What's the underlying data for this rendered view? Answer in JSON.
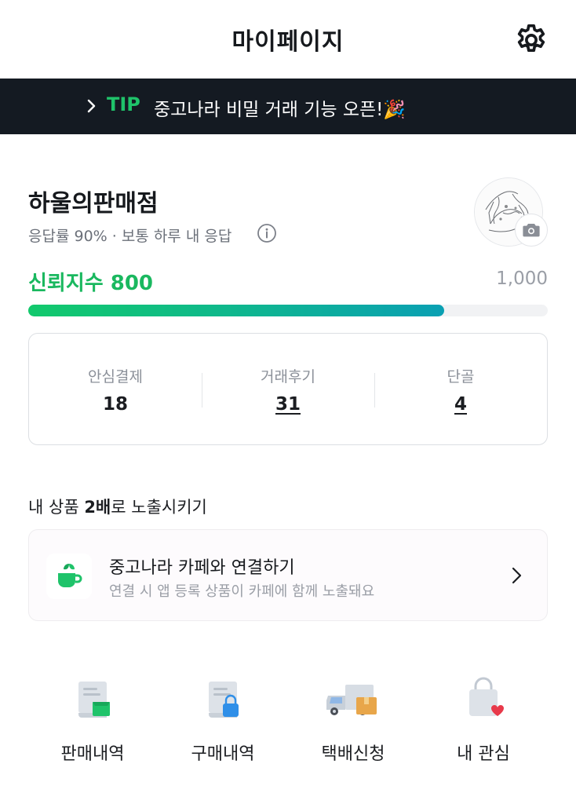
{
  "header": {
    "title": "마이페이지",
    "settings_icon": "gear-icon"
  },
  "tip": {
    "label": "TIP",
    "text": "중고나라 비밀 거래 기능 오픈!🎉"
  },
  "profile": {
    "store_name": "하울의판매점",
    "response_info": "응답률 90% · 보통 하루 내 응답",
    "camera_icon": "camera-icon"
  },
  "trust": {
    "label": "신뢰지수 800",
    "score": 800,
    "max_label": "1,000",
    "max": 1000
  },
  "stats": [
    {
      "label": "안심결제",
      "value": "18"
    },
    {
      "label": "거래후기",
      "value": "31"
    },
    {
      "label": "단골",
      "value": "4"
    }
  ],
  "exposure": {
    "title_prefix": "내 상품 ",
    "title_bold": "2배",
    "title_suffix": "로 노출시키기",
    "card_title": "중고나라 카페와 연결하기",
    "card_sub": "연결 시 앱 등록 상품이 카페에 함께 노출돼요"
  },
  "menu": [
    {
      "label": "판매내역",
      "icon": "sales-history-icon"
    },
    {
      "label": "구매내역",
      "icon": "purchase-history-icon"
    },
    {
      "label": "택배신청",
      "icon": "delivery-truck-icon"
    },
    {
      "label": "내 관심",
      "icon": "favorites-bag-icon"
    }
  ],
  "colors": {
    "accent_green": "#1ab85f",
    "banner_bg": "#141a22",
    "heart": "#e8394a"
  }
}
